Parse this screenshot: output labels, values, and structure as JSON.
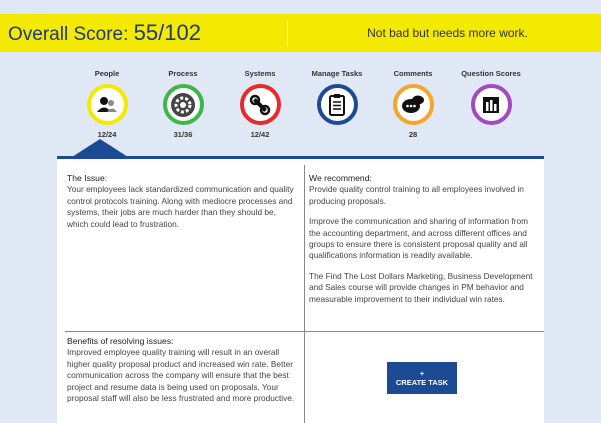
{
  "header": {
    "score_label": "Overall Score:",
    "score_value": "55/102",
    "verdict": "Not bad but needs more work."
  },
  "categories": [
    {
      "label": "People",
      "count": "12/24",
      "color": "#f4e900",
      "icon": "people-icon"
    },
    {
      "label": "Process",
      "count": "31/36",
      "color": "#3cb84a",
      "icon": "gear-icon"
    },
    {
      "label": "Systems",
      "count": "12/42",
      "color": "#e52b2b",
      "icon": "tools-icon"
    },
    {
      "label": "Manage Tasks",
      "count": "",
      "color": "#1c4b93",
      "icon": "clipboard-icon"
    },
    {
      "label": "Comments",
      "count": "28",
      "color": "#f7a52a",
      "icon": "chat-icon"
    },
    {
      "label": "Question Scores",
      "count": "",
      "color": "#a24ac0",
      "icon": "bar-chart-icon"
    }
  ],
  "issue": {
    "heading": "The Issue:",
    "text": "Your employees lack standardized communication and quality control protocols training. Along with mediocre processes and systems, their jobs are much harder than they should be, which could lead to frustration."
  },
  "recommend": {
    "heading": "We recommend:",
    "p1": "Provide quality control training to all employees involved in producing proposals.",
    "p2": "Improve the communication and sharing of information from the accounting department, and across different offices and groups to ensure there is consistent proposal quality and all qualifications information is readily available.",
    "p3": "The Find The Lost Dollars Marketing, Business Development and Sales course will provide changes in PM behavior and measurable improvement to their individual win rates."
  },
  "benefits": {
    "heading": "Benefits of resolving issues:",
    "text": "Improved employee quality training will result in an overall higher quality proposal product and increased win rate. Better communication across the company will ensure that the best project and resume data is being used on proposals. Your proposal staff will also be less frustrated and more productive."
  },
  "task_button": {
    "plus": "+",
    "label": "CREATE TASK"
  }
}
